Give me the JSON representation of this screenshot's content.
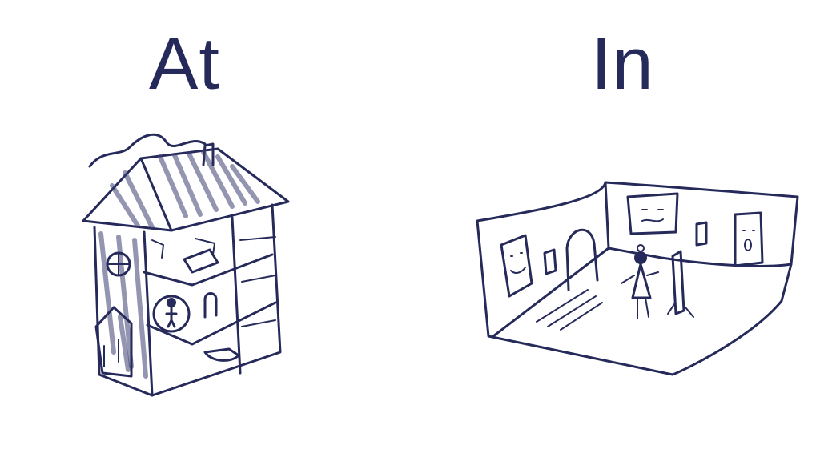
{
  "labels": {
    "left": "At",
    "right": "In"
  },
  "colors": {
    "ink": "#262a5a",
    "background": "#ffffff"
  }
}
